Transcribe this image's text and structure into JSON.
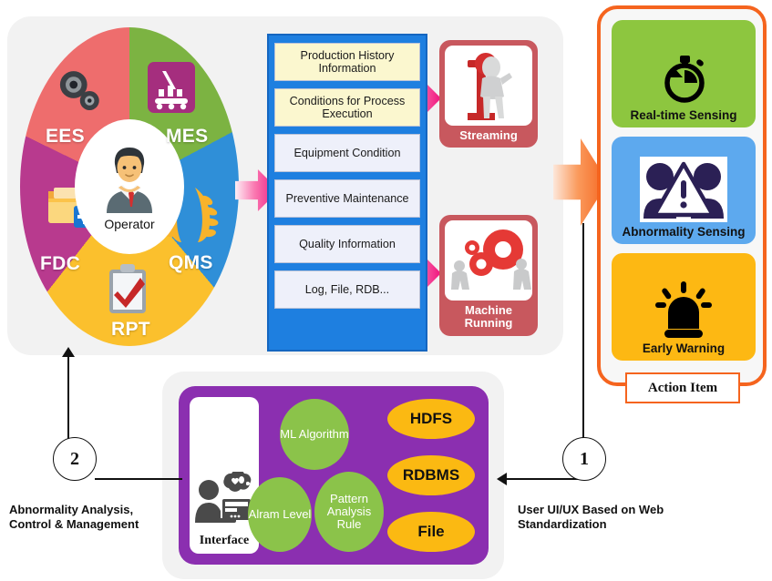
{
  "wheel": {
    "center_label": "Operator",
    "segments": [
      {
        "label": "EES",
        "color": "#ee6d6d",
        "icon": "gears-icon"
      },
      {
        "label": "MES",
        "color": "#7cb342",
        "icon": "conveyor-crane-icon"
      },
      {
        "label": "QMS",
        "color": "#2f8fd8",
        "icon": "laurel-wreath-icon"
      },
      {
        "label": "RPT",
        "color": "#fbc02d",
        "icon": "clipboard-check-icon"
      },
      {
        "label": "FDC",
        "color": "#b83a8e",
        "icon": "folder-plus-icon"
      }
    ]
  },
  "data_list": {
    "box_color": "#1e7fe0",
    "items": [
      {
        "label": "Production History Information",
        "style": "yellow"
      },
      {
        "label": "Conditions for Process Execution",
        "style": "yellow"
      },
      {
        "label": "Equipment Condition",
        "style": "lavender"
      },
      {
        "label": "Preventive Maintenance",
        "style": "lavender"
      },
      {
        "label": "Quality Information",
        "style": "lavender"
      },
      {
        "label": "Log, File, RDB...",
        "style": "lavender"
      }
    ]
  },
  "process_cards": [
    {
      "label": "Streaming",
      "icon": "person-data-streaming-icon",
      "color": "#c8585e"
    },
    {
      "label": "Machine Running",
      "icon": "gears-workers-icon",
      "color": "#c8585e"
    }
  ],
  "action_panel": {
    "title": "Action Item",
    "border_color": "#F5641E",
    "cards": [
      {
        "label": "Real-time Sensing",
        "icon": "stopwatch-icon",
        "color": "#8DC63F"
      },
      {
        "label": "Abnormality Sensing",
        "icon": "people-warning-icon",
        "color": "#5DA9EE"
      },
      {
        "label": "Early Warning",
        "icon": "alarm-beacon-icon",
        "color": "#FDB813"
      }
    ]
  },
  "platform": {
    "panel_color": "#8B2FB0",
    "interface": {
      "label": "Interface",
      "icon": "user-monitor-thought-icon"
    },
    "green_nodes": [
      {
        "label": "ML Algorithm"
      },
      {
        "label": "Alram Level"
      },
      {
        "label": "Pattern Analysis Rule"
      }
    ],
    "storage_nodes": [
      {
        "label": "HDFS"
      },
      {
        "label": "RDBMS"
      },
      {
        "label": "File"
      }
    ]
  },
  "callouts": [
    {
      "number": "1",
      "caption": "User UI/UX Based on Web Standardization"
    },
    {
      "number": "2",
      "caption": "Abnormality Analysis, Control & Management"
    }
  ]
}
